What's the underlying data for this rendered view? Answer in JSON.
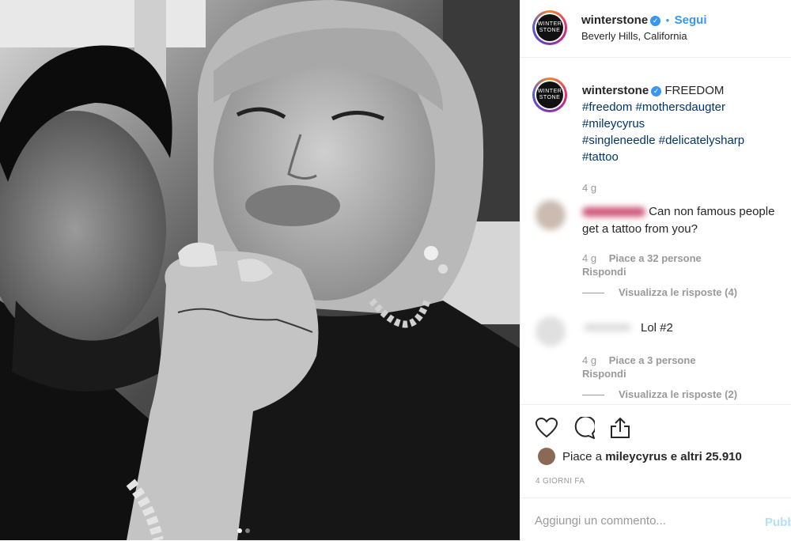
{
  "header": {
    "username": "winterstone",
    "follow_separator": "•",
    "follow_label": "Segui",
    "location": "Beverly Hills, California",
    "avatar_text": "WINTER STONE"
  },
  "caption": {
    "username": "winterstone",
    "text": "FREEDOM",
    "hashtags": [
      "#freedom",
      "#mothersdaugter",
      "#mileycyrus",
      "#singleneedle",
      "#delicatelysharp",
      "#tattoo"
    ],
    "time": "4 g"
  },
  "comments": [
    {
      "text": "Can non famous people get a tattoo from you?",
      "time": "4 g",
      "likes": "Piace a 32 persone",
      "reply_label": "Rispondi",
      "view_replies": "Visualizza le risposte (4)"
    },
    {
      "text": "Lol #2",
      "time": "4 g",
      "likes": "Piace a 3 persone",
      "reply_label": "Rispondi",
      "view_replies": "Visualizza le risposte (2)"
    }
  ],
  "likes": {
    "prefix": "Piace a",
    "user": "mileycyrus",
    "suffix": "e altri 25.910"
  },
  "posted_time": "4 GIORNI FA",
  "add_comment": {
    "placeholder": "Aggiungi un commento...",
    "publish_label": "Pubblica"
  },
  "icons": {
    "like": "heart-icon",
    "comment": "comment-bubble-icon",
    "share": "share-icon",
    "verified": "verified-badge-icon"
  },
  "colors": {
    "link_blue": "#3897f0",
    "hashtag": "#003569",
    "muted": "#999999",
    "publish_disabled": "#b2dffc"
  },
  "carousel": {
    "total": 2,
    "active": 1
  }
}
